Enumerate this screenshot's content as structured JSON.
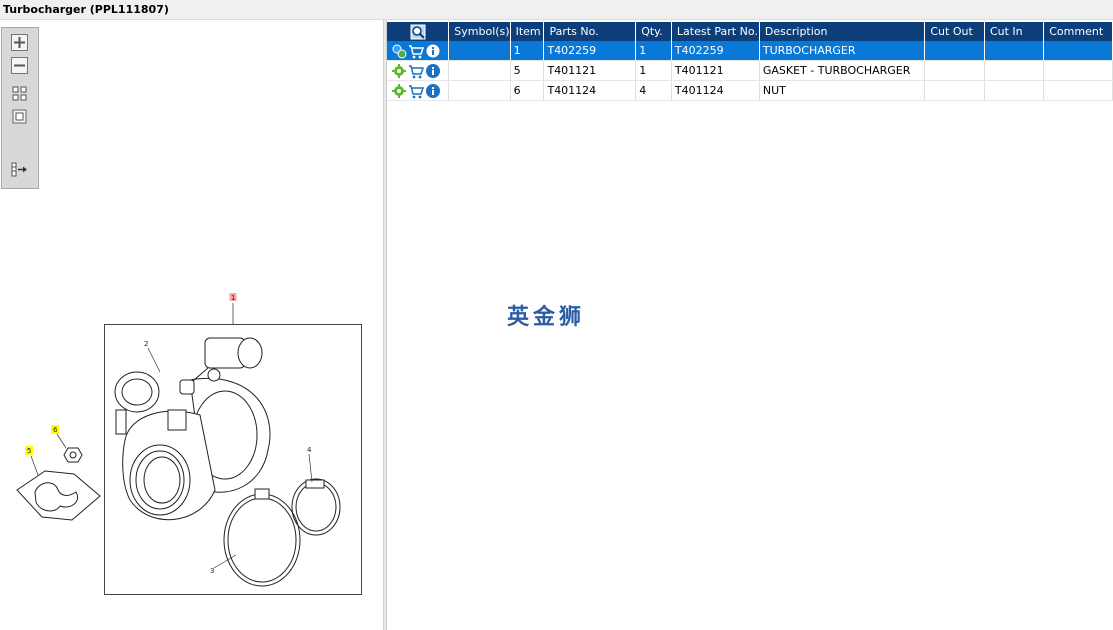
{
  "window": {
    "title": "Turbocharger (PPL111807)"
  },
  "toolbar": {
    "buttons": [
      {
        "name": "zoom-in-button",
        "icon": "zoom-in-icon"
      },
      {
        "name": "zoom-out-button",
        "icon": "zoom-out-icon"
      },
      {
        "name": "fit-all-button",
        "icon": "grid-fit-icon"
      },
      {
        "name": "actual-size-button",
        "icon": "square-frame-icon"
      },
      {
        "name": "split-view-button",
        "icon": "split-view-icon"
      }
    ]
  },
  "diagram": {
    "callouts": {
      "c1": "1",
      "c2": "2",
      "c3": "3",
      "c4": "4",
      "c5": "5",
      "c6": "6"
    },
    "highlight_color": "#ffff00",
    "selected_color": "#f7a6a6"
  },
  "table": {
    "columns": [
      "",
      "Symbol(s)",
      "Item",
      "Parts No.",
      "Qty.",
      "Latest Part No.",
      "Description",
      "Cut Out",
      "Cut In",
      "Comment"
    ],
    "rows": [
      {
        "symbols": "",
        "item": "1",
        "part_no": "T402259",
        "qty": "1",
        "latest_part_no": "T402259",
        "description": "TURBOCHARGER",
        "cut_out": "",
        "cut_in": "",
        "comment": "",
        "selected": true
      },
      {
        "symbols": "",
        "item": "5",
        "part_no": "T401121",
        "qty": "1",
        "latest_part_no": "T401121",
        "description": "GASKET - TURBOCHARGER",
        "cut_out": "",
        "cut_in": "",
        "comment": "",
        "selected": false
      },
      {
        "symbols": "",
        "item": "6",
        "part_no": "T401124",
        "qty": "4",
        "latest_part_no": "T401124",
        "description": "NUT",
        "cut_out": "",
        "cut_in": "",
        "comment": "",
        "selected": false
      }
    ]
  },
  "watermark": {
    "text": "英金狮"
  },
  "colors": {
    "header_bg": "#0c3f7a",
    "selected_row": "#0a78d7"
  }
}
